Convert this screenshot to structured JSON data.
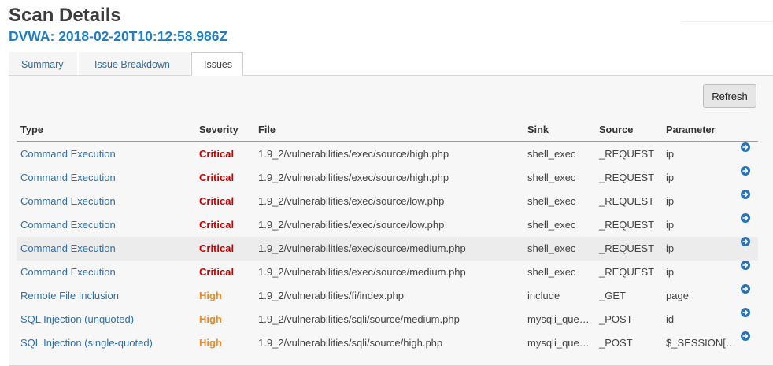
{
  "header": {
    "title": "Scan Details",
    "subtitle": "DVWA: 2018-02-20T10:12:58.986Z"
  },
  "tabs": [
    {
      "label": "Summary"
    },
    {
      "label": "Issue Breakdown"
    },
    {
      "label": "Issues",
      "active": true
    }
  ],
  "toolbar": {
    "refresh_label": "Refresh"
  },
  "table": {
    "columns": [
      "Type",
      "Severity",
      "File",
      "Sink",
      "Source",
      "Parameter"
    ],
    "rows": [
      {
        "type": "Command Execution",
        "severity": "Critical",
        "file": "1.9_2/vulnerabilities/exec/source/high.php",
        "sink": "shell_exec",
        "source": "_REQUEST",
        "parameter": "ip"
      },
      {
        "type": "Command Execution",
        "severity": "Critical",
        "file": "1.9_2/vulnerabilities/exec/source/high.php",
        "sink": "shell_exec",
        "source": "_REQUEST",
        "parameter": "ip"
      },
      {
        "type": "Command Execution",
        "severity": "Critical",
        "file": "1.9_2/vulnerabilities/exec/source/low.php",
        "sink": "shell_exec",
        "source": "_REQUEST",
        "parameter": "ip"
      },
      {
        "type": "Command Execution",
        "severity": "Critical",
        "file": "1.9_2/vulnerabilities/exec/source/low.php",
        "sink": "shell_exec",
        "source": "_REQUEST",
        "parameter": "ip"
      },
      {
        "type": "Command Execution",
        "severity": "Critical",
        "file": "1.9_2/vulnerabilities/exec/source/medium.php",
        "sink": "shell_exec",
        "source": "_REQUEST",
        "parameter": "ip",
        "highlighted": true
      },
      {
        "type": "Command Execution",
        "severity": "Critical",
        "file": "1.9_2/vulnerabilities/exec/source/medium.php",
        "sink": "shell_exec",
        "source": "_REQUEST",
        "parameter": "ip"
      },
      {
        "type": "Remote File Inclusion",
        "severity": "High",
        "file": "1.9_2/vulnerabilities/fi/index.php",
        "sink": "include",
        "source": "_GET",
        "parameter": "page"
      },
      {
        "type": "SQL Injection (unquoted)",
        "severity": "High",
        "file": "1.9_2/vulnerabilities/sqli/source/medium.php",
        "sink": "mysqli_que…",
        "source": "_POST",
        "parameter": "id"
      },
      {
        "type": "SQL Injection (single-quoted)",
        "severity": "High",
        "file": "1.9_2/vulnerabilities/sqli/source/high.php",
        "sink": "mysqli_que…",
        "source": "_POST",
        "parameter": "$_SESSION[…"
      }
    ]
  },
  "colors": {
    "link": "#2a72b5",
    "critical": "#cc0000",
    "high": "#f08a24",
    "subtitle": "#1f7ec4"
  },
  "icons": {
    "row_action": "arrow-circle-right-icon"
  }
}
